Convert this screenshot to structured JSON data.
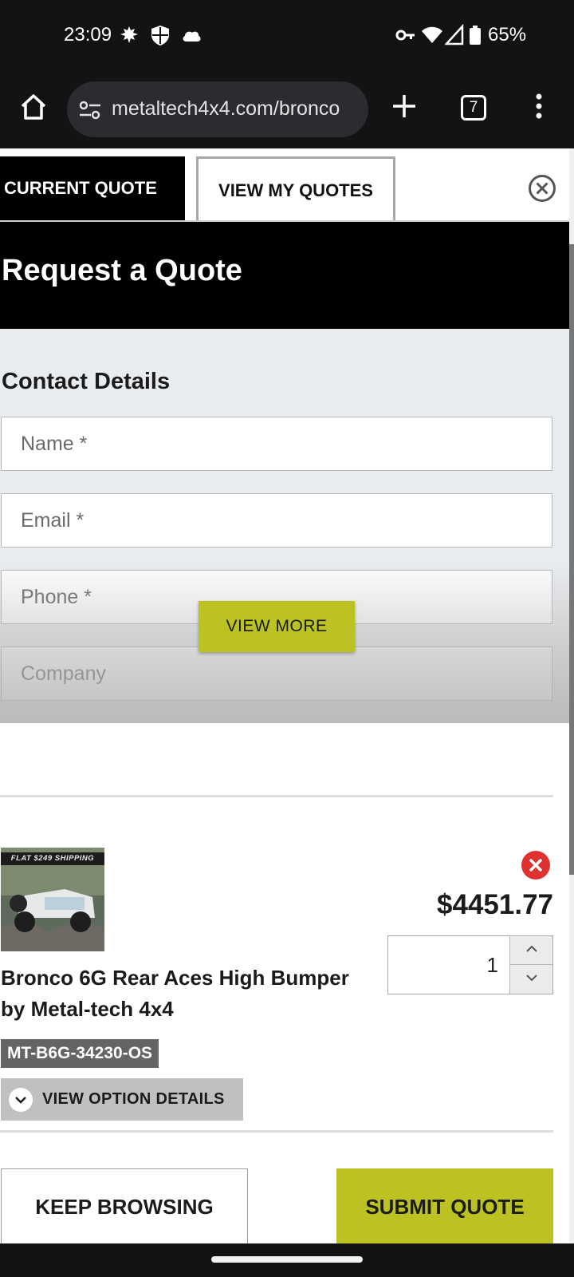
{
  "status_bar": {
    "time": "23:09",
    "battery": "65%",
    "left_icons": [
      "notification-icon",
      "shield-icon",
      "cloud-icon"
    ],
    "right_icons": [
      "vpn-key-icon",
      "wifi-icon",
      "signal-icon",
      "battery-icon"
    ]
  },
  "browser": {
    "url": "metaltech4x4.com/bronco",
    "tab_count": "7"
  },
  "tabs": {
    "current": "CURRENT QUOTE",
    "mine": "VIEW MY QUOTES"
  },
  "quote": {
    "title": "Request a Quote",
    "contact_title": "Contact Details",
    "fields": {
      "name_placeholder": "Name *",
      "email_placeholder": "Email *",
      "phone_placeholder": "Phone *",
      "company_placeholder": "Company"
    },
    "view_more": "VIEW MORE"
  },
  "item": {
    "banner": "FLAT $249 SHIPPING",
    "name": "Bronco 6G Rear Aces High Bumper by Metal-tech 4x4",
    "sku": "MT-B6G-34230-OS",
    "price": "$4451.77",
    "quantity": "1",
    "option_details": "VIEW OPTION DETAILS"
  },
  "actions": {
    "keep_browsing": "KEEP BROWSING",
    "submit_quote": "SUBMIT QUOTE"
  },
  "colors": {
    "accent": "#bcc222",
    "remove": "#e03131",
    "header": "#000000"
  }
}
